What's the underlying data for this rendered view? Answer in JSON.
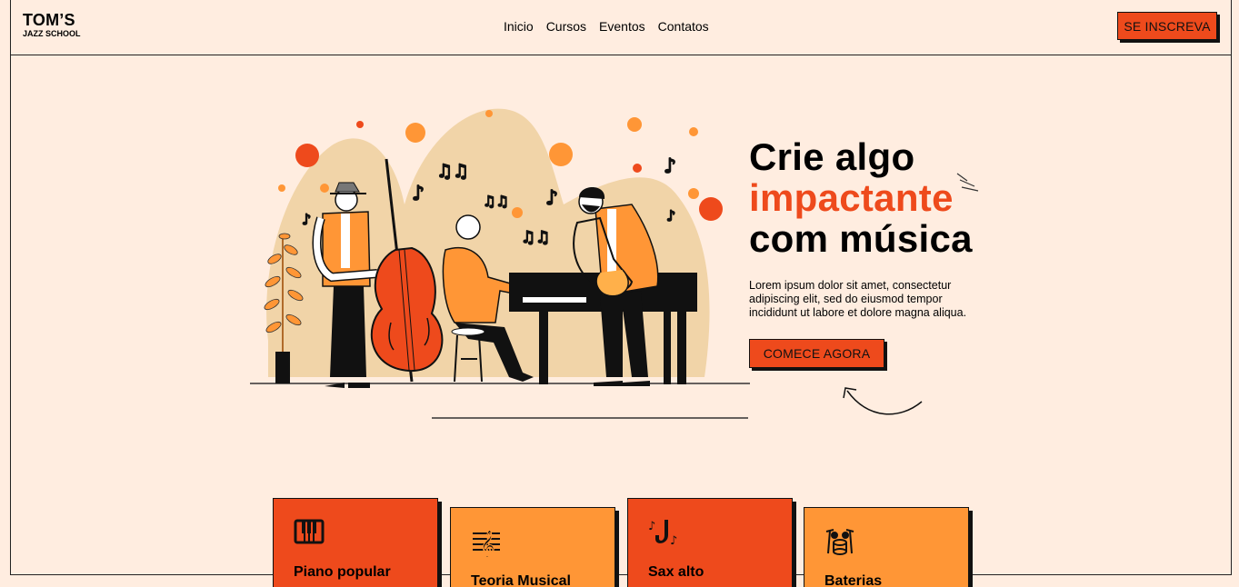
{
  "brand": {
    "line1": "TOM’S",
    "line2": "JAZZ SCHOOL"
  },
  "nav": {
    "items": [
      "Inicio",
      "Cursos",
      "Eventos",
      "Contatos"
    ]
  },
  "header": {
    "signup_label": "SE INSCREVA"
  },
  "hero": {
    "line1": "Crie algo",
    "line2": "impactante",
    "line3": "com música",
    "description": "Lorem ipsum dolor sit amet, consectetur adipiscing elit, sed do eiusmod tempor incididunt ut labore et dolore magna aliqua.",
    "cta_label": "COMECE AGORA"
  },
  "courses": [
    {
      "name": "Piano popular",
      "icon": "piano-keys-icon",
      "color": "#ee4a1c"
    },
    {
      "name": "Teoria Musical",
      "icon": "treble-clef-staff-icon",
      "color": "#ff9636"
    },
    {
      "name": "Sax alto",
      "icon": "saxophone-icon",
      "color": "#ee4a1c"
    },
    {
      "name": "Baterias",
      "icon": "drum-kit-icon",
      "color": "#ff9636"
    }
  ],
  "colors": {
    "background": "#ffede0",
    "accent": "#ee4a1c",
    "orange": "#ff9636",
    "beige": "#f1d4a8"
  }
}
